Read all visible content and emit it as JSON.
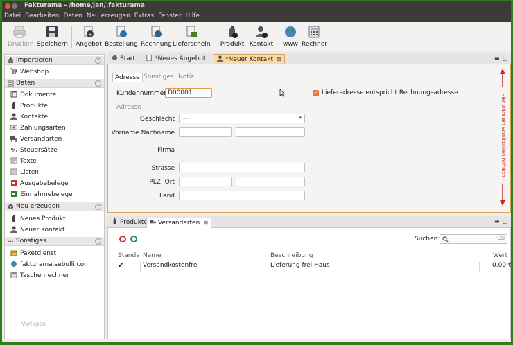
{
  "window": {
    "title": "Fakturama - /home/jan/.fakturama"
  },
  "menu": [
    "Datei",
    "Bearbeiten",
    "Daten",
    "Neu erzeugen",
    "Extras",
    "Fenster",
    "Hilfe"
  ],
  "toolbar": {
    "print": "Drucken",
    "save": "Speichern",
    "offer": "Angebot",
    "order": "Bestellung",
    "invoice": "Rechnung",
    "delivery": "Lieferschein",
    "product": "Produkt",
    "contact": "Kontakt",
    "www": "www",
    "calculator": "Rechner"
  },
  "sidebar": {
    "import": {
      "title": "Importieren",
      "items": [
        "Webshop"
      ]
    },
    "data": {
      "title": "Daten",
      "items": [
        "Dokumente",
        "Produkte",
        "Kontakte",
        "Zahlungsarten",
        "Versandarten",
        "Steuersätze",
        "Texte",
        "Listen",
        "Ausgabebelege",
        "Einnahmebelege"
      ]
    },
    "create": {
      "title": "Neu erzeugen",
      "items": [
        "Neues Produkt",
        "Neuer Kontakt"
      ]
    },
    "misc": {
      "title": "Sonstiges",
      "items": [
        "Paketdienst",
        "fakturama.sebulli.com",
        "Taschenrechner"
      ]
    },
    "footer": "Vorlagen"
  },
  "editor": {
    "tabs": [
      "Start",
      "*Neues Angebot",
      "*Neuer Kontakt"
    ],
    "subtabs": [
      "Adresse",
      "Sonstiges",
      "Notiz"
    ],
    "customer_number_label": "Kundennummer",
    "customer_number": "D00001",
    "same_address_label": "Lieferadresse entspricht Rechnungsadresse",
    "address_section": "Adresse",
    "gender_label": "Geschlecht",
    "gender_value": "---",
    "name_label": "Vorname Nachname",
    "company_label": "Firma",
    "street_label": "Strasse",
    "city_label": "PLZ, Ort",
    "country_label": "Land",
    "scroll_note": "Hier wäre ein Scrollbalken hilfreich"
  },
  "lower": {
    "tabs": [
      "Produkte",
      "Versandarten"
    ],
    "search_label": "Suchen:",
    "columns": [
      "Standa",
      "Name",
      "Beschreibung",
      "Wert"
    ],
    "rows": [
      {
        "standard": "✔",
        "name": "Versandkostenfrei",
        "description": "Lieferung frei Haus",
        "value": "0,00 €"
      }
    ]
  },
  "colors": {
    "accent": "#e9733d",
    "active_tab": "#fbd9a6",
    "background": "#2f7d1e",
    "note": "#cc2a1e"
  }
}
